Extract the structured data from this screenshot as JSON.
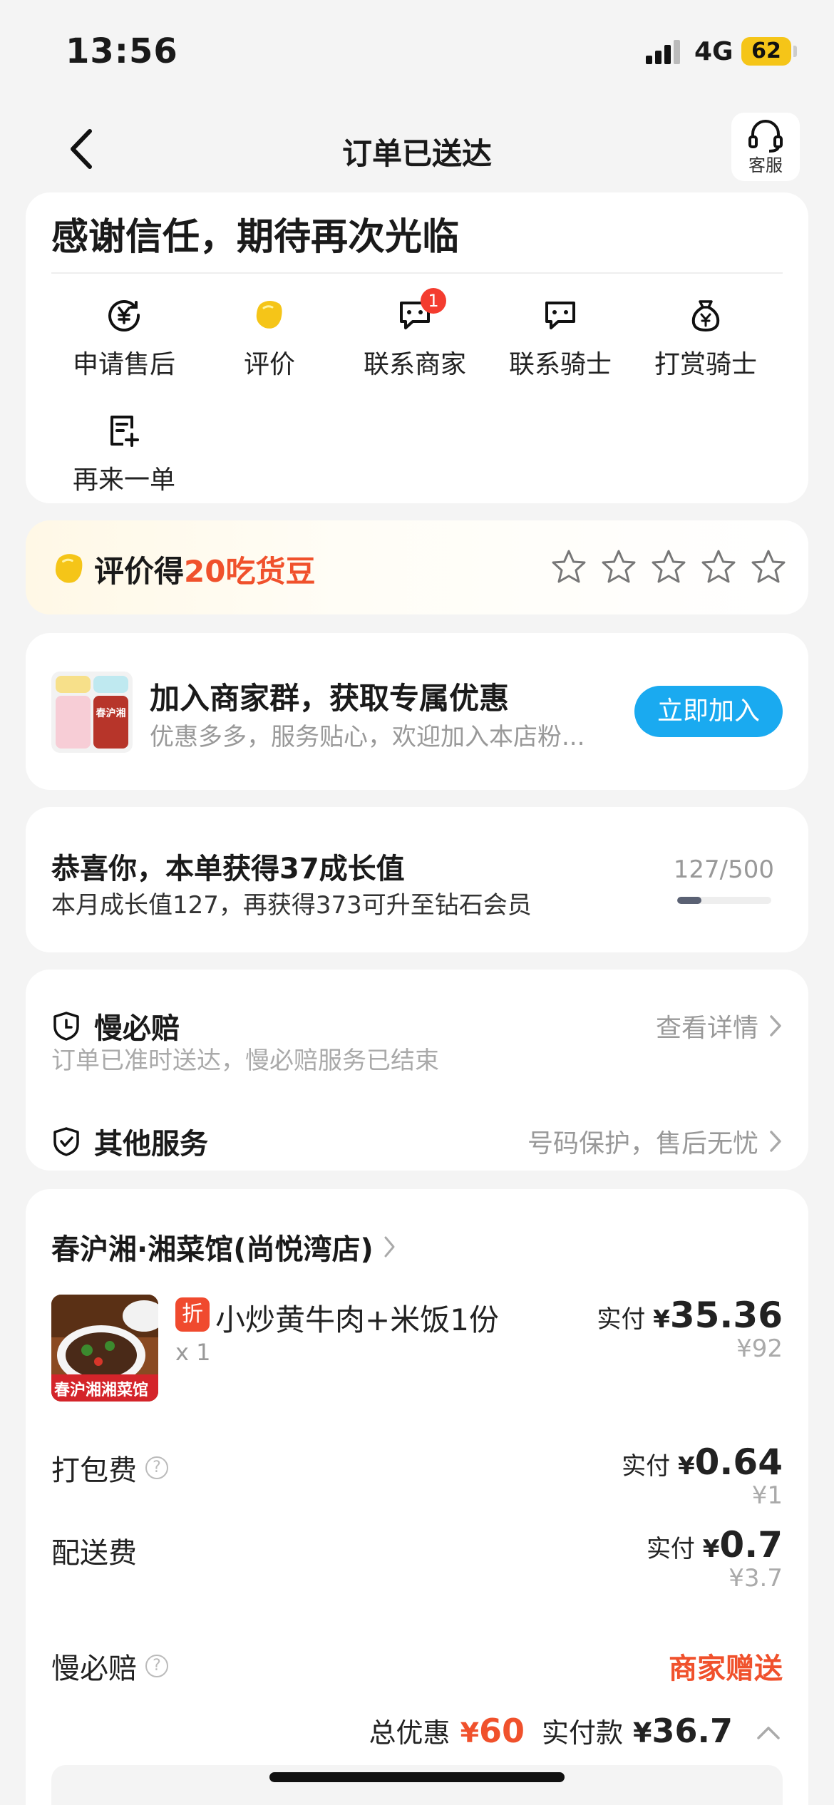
{
  "status_bar": {
    "time": "13:56",
    "network": "4G",
    "battery": "62"
  },
  "nav": {
    "title": "订单已送达",
    "service_label": "客服"
  },
  "thanks": {
    "title": "感谢信任，期待再次光临"
  },
  "actions": [
    {
      "label": "申请售后",
      "icon": "after-sales-icon"
    },
    {
      "label": "评价",
      "icon": "review-bean-icon"
    },
    {
      "label": "联系商家",
      "icon": "chat-icon",
      "badge": "1"
    },
    {
      "label": "联系骑士",
      "icon": "chat-icon"
    },
    {
      "label": "打赏骑士",
      "icon": "money-bag-icon"
    },
    {
      "label": "再来一单",
      "icon": "reorder-icon"
    }
  ],
  "review": {
    "prefix": "评价得",
    "highlight": "20吃货豆",
    "star_count": 5,
    "rating": 0
  },
  "group": {
    "title": "加入商家群，获取专属优惠",
    "subtitle": "优惠多多，服务贴心，欢迎加入本店粉...",
    "button": "立即加入",
    "avatar_tile": "春沪湘"
  },
  "growth": {
    "title": "恭喜你，本单获得37成长值",
    "subtitle": "本月成长值127，再获得373可升至钻石会员",
    "count": "127/500",
    "progress": 0.254
  },
  "services": {
    "slow_compensation": {
      "title": "慢必赔",
      "right": "查看详情",
      "sub": "订单已准时送达，慢必赔服务已结束"
    },
    "other": {
      "title": "其他服务",
      "right": "号码保护，售后无忧"
    }
  },
  "order": {
    "shop": "春沪湘·湘菜馆(尚悦湾店)",
    "item": {
      "tag": "折",
      "name": "小炒黄牛肉+米饭1份",
      "qty": "x 1",
      "paid_label": "实付",
      "yen": "¥",
      "paid": "35.36",
      "original": "¥92",
      "image_text": "春沪湘湘菜馆"
    },
    "packing": {
      "label": "打包费",
      "paid_label": "实付",
      "yen": "¥",
      "paid": "0.64",
      "original": "¥1"
    },
    "delivery": {
      "label": "配送费",
      "paid_label": "实付",
      "yen": "¥",
      "paid": "0.7",
      "original": "¥3.7"
    },
    "slow": {
      "label": "慢必赔",
      "value": "商家赠送"
    },
    "totals": {
      "discount_label": "总优惠",
      "discount_yen": "¥",
      "discount": "60",
      "paid_label": "实付款",
      "paid_yen": "¥",
      "paid": "36.7"
    }
  },
  "colors": {
    "accent_red": "#f0512c",
    "join_blue": "#1aaaf0",
    "bean_yellow": "#f5c518"
  }
}
